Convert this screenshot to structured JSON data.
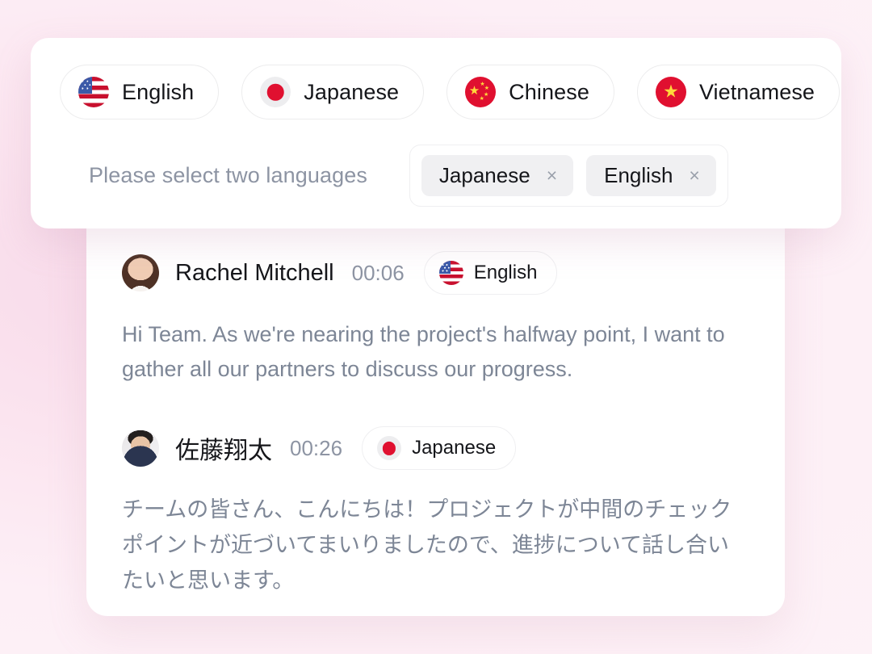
{
  "language_selector": {
    "chips": [
      {
        "label": "English",
        "flag": "flag-us",
        "flag_name": "us-flag-icon"
      },
      {
        "label": "Japanese",
        "flag": "flag-jp",
        "flag_name": "japan-flag-icon"
      },
      {
        "label": "Chinese",
        "flag": "flag-cn",
        "flag_name": "china-flag-icon"
      },
      {
        "label": "Vietnamese",
        "flag": "flag-vn",
        "flag_name": "vietnam-flag-icon"
      }
    ],
    "placeholder": "Please select two languages",
    "selected": [
      {
        "label": "Japanese",
        "remove": "×"
      },
      {
        "label": "English",
        "remove": "×"
      }
    ]
  },
  "transcript": {
    "messages": [
      {
        "speaker": "Rachel Mitchell",
        "timestamp": "00:06",
        "language": "English",
        "flag": "flag-us",
        "text": "Hi Team. As we're nearing the project's halfway point, I want to gather all our partners to discuss our progress."
      },
      {
        "speaker": "佐藤翔太",
        "timestamp": "00:26",
        "language": "Japanese",
        "flag": "flag-jp",
        "text": "チームの皆さん、こんにちは！プロジェクトが中間のチェックポイントが近づいてまいりましたので、進捗について話し合いたいと思います。"
      }
    ]
  },
  "colors": {
    "background_pink": "#fbe4ef",
    "panel_white": "#ffffff",
    "accent_red": "#e01030",
    "accent_yellow": "#ffd93b",
    "muted_text": "#7d8696",
    "placeholder_text": "#8d94a3",
    "tag_background": "#f0f0f2"
  }
}
